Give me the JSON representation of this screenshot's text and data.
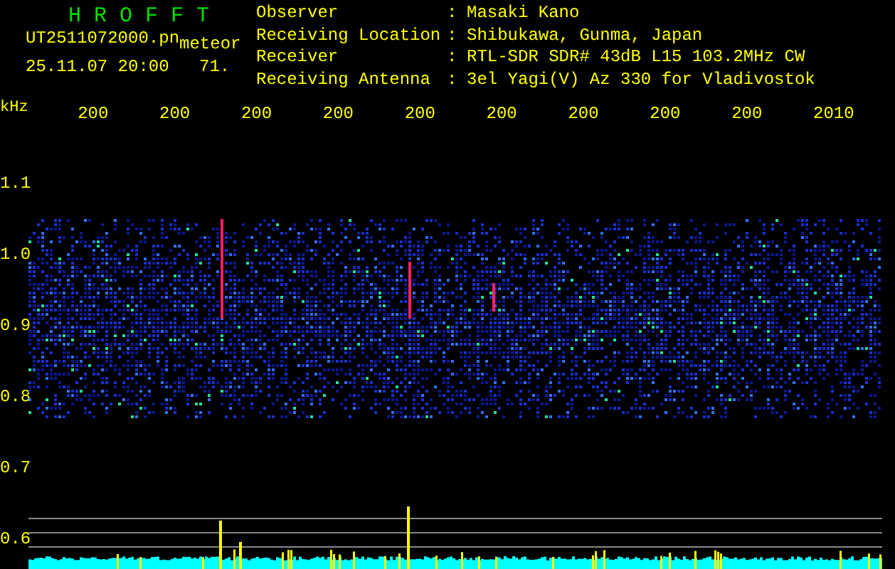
{
  "app": {
    "title": "H R O F F T"
  },
  "file": {
    "name": "UT2511072000.pn",
    "datetime": "25.11.07 20:00",
    "detection_label": "meteor",
    "detection_value": "71."
  },
  "station": [
    {
      "label": "Observer",
      "separator": ":",
      "value": "Masaki Kano"
    },
    {
      "label": "Receiving Location",
      "separator": ":",
      "value": "Shibukawa, Gunma, Japan"
    },
    {
      "label": "Receiver",
      "separator": ":",
      "value": "RTL-SDR SDR# 43dB L15 103.2MHz CW"
    },
    {
      "label": "Receiving Antenna",
      "separator": ":",
      "value": "3el Yagi(V) Az 330 for Vladivostok"
    }
  ],
  "time_axis": {
    "labels": [
      "200",
      "200",
      "200",
      "200",
      "200",
      "200",
      "200",
      "200",
      "200",
      "2010"
    ]
  },
  "frequency_axis": {
    "unit": "kHz",
    "labels": [
      "1.1",
      "1.0",
      "0.9",
      "0.8",
      "0.7",
      "0.6"
    ]
  }
}
